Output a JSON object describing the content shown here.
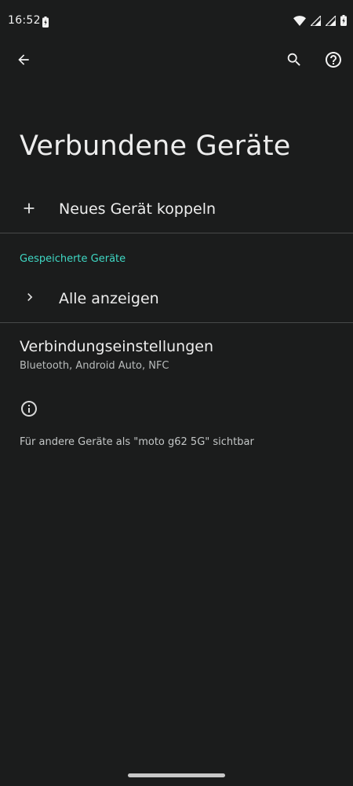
{
  "status_bar": {
    "time": "16:52",
    "icons": [
      "battery-saver-icon",
      "wifi-icon",
      "signal-icon",
      "signal-icon",
      "battery-icon"
    ]
  },
  "app_bar": {
    "back_icon": "arrow-back-icon",
    "search_icon": "search-icon",
    "help_icon": "help-icon"
  },
  "title": "Verbundene Geräte",
  "pair_new": {
    "icon": "plus-icon",
    "label": "Neues Gerät koppeln"
  },
  "saved_devices": {
    "header": "Gespeicherte Geräte",
    "show_all_icon": "chevron-right-icon",
    "show_all_label": "Alle anzeigen"
  },
  "connection_settings": {
    "title": "Verbindungseinstellungen",
    "subtitle": "Bluetooth, Android Auto, NFC"
  },
  "visibility": {
    "icon": "info-icon",
    "text": "Für andere Geräte als \"moto g62 5G\" sichtbar"
  },
  "colors": {
    "background": "#1b1c1c",
    "accent": "#3fd8c4",
    "text_primary": "#ededed",
    "text_secondary": "#b9bcbc",
    "divider": "#474949"
  }
}
